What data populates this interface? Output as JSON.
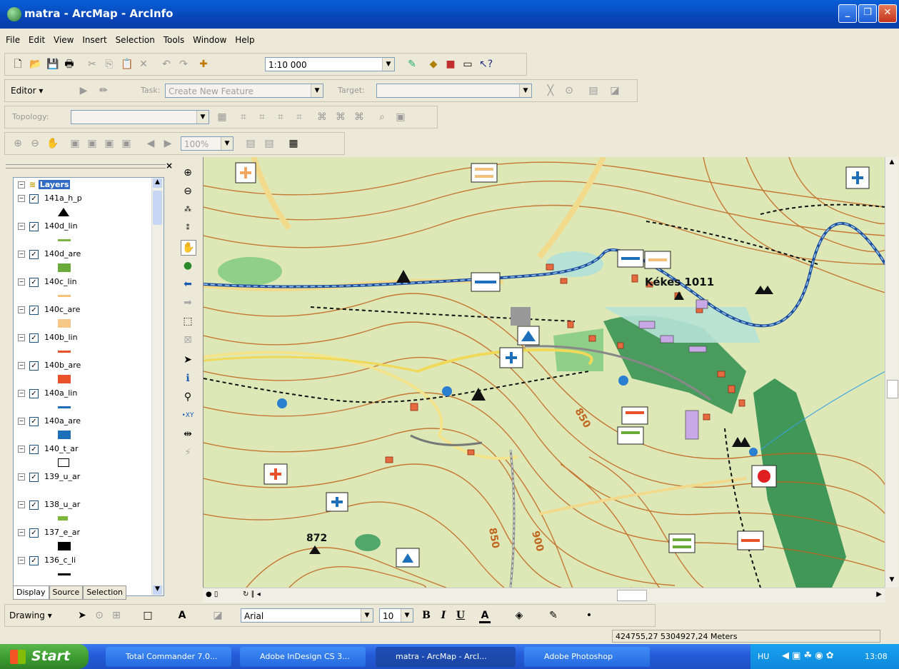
{
  "window": {
    "title": "matra - ArcMap - ArcInfo",
    "min": "_",
    "max": "❐",
    "close": "✕"
  },
  "menu": [
    "File",
    "Edit",
    "View",
    "Insert",
    "Selection",
    "Tools",
    "Window",
    "Help"
  ],
  "standard": {
    "scale": "1:10 000"
  },
  "editor": {
    "label": "Editor ▾",
    "task_label": "Task:",
    "task_value": "Create New Feature",
    "target_label": "Target:"
  },
  "topology": {
    "label": "Topology:"
  },
  "layout": {
    "zoom": "100%"
  },
  "toc": {
    "root": "Layers",
    "layers": [
      {
        "name": "141a_h_p",
        "sym": "triangle",
        "color": "#000000"
      },
      {
        "name": "140d_lin",
        "sym": "line",
        "color": "#7cb342"
      },
      {
        "name": "140d_are",
        "sym": "rect",
        "color": "#6aaa3a"
      },
      {
        "name": "140c_lin",
        "sym": "line",
        "color": "#f7c27a"
      },
      {
        "name": "140c_are",
        "sym": "rect",
        "color": "#f5c887"
      },
      {
        "name": "140b_lin",
        "sym": "line",
        "color": "#e8502a"
      },
      {
        "name": "140b_are",
        "sym": "rect",
        "color": "#e8502a"
      },
      {
        "name": "140a_lin",
        "sym": "line",
        "color": "#1d6fba"
      },
      {
        "name": "140a_are",
        "sym": "rect",
        "color": "#1d6fba"
      },
      {
        "name": "140_t_ar",
        "sym": "hollow",
        "color": "#000000"
      },
      {
        "name": "139_u_ar",
        "sym": "none",
        "color": ""
      },
      {
        "name": "138_u_ar",
        "sym": "smallrect",
        "color": "#7ab83a"
      },
      {
        "name": "137_e_ar",
        "sym": "rect",
        "color": "#000000"
      },
      {
        "name": "136_c_li",
        "sym": "line",
        "color": "#000000"
      }
    ],
    "tabs": [
      "Display",
      "Source",
      "Selection"
    ]
  },
  "map": {
    "labels": {
      "kekes": "Kékes 1011",
      "p872": "872",
      "c850a": "850",
      "c850b": "850",
      "c900": "900"
    }
  },
  "drawing": {
    "label": "Drawing ▾",
    "font": "Arial",
    "size": "10",
    "bold": "B",
    "italic": "I",
    "underline": "U"
  },
  "status": {
    "coords": "424755,27  5304927,24 Meters"
  },
  "taskbar": {
    "start": "Start",
    "items": [
      "Total Commander 7.0...",
      "Adobe InDesign CS 3...",
      "matra - ArcMap - ArcI...",
      "Adobe Photoshop"
    ],
    "lang": "HU",
    "time": "13:08"
  }
}
